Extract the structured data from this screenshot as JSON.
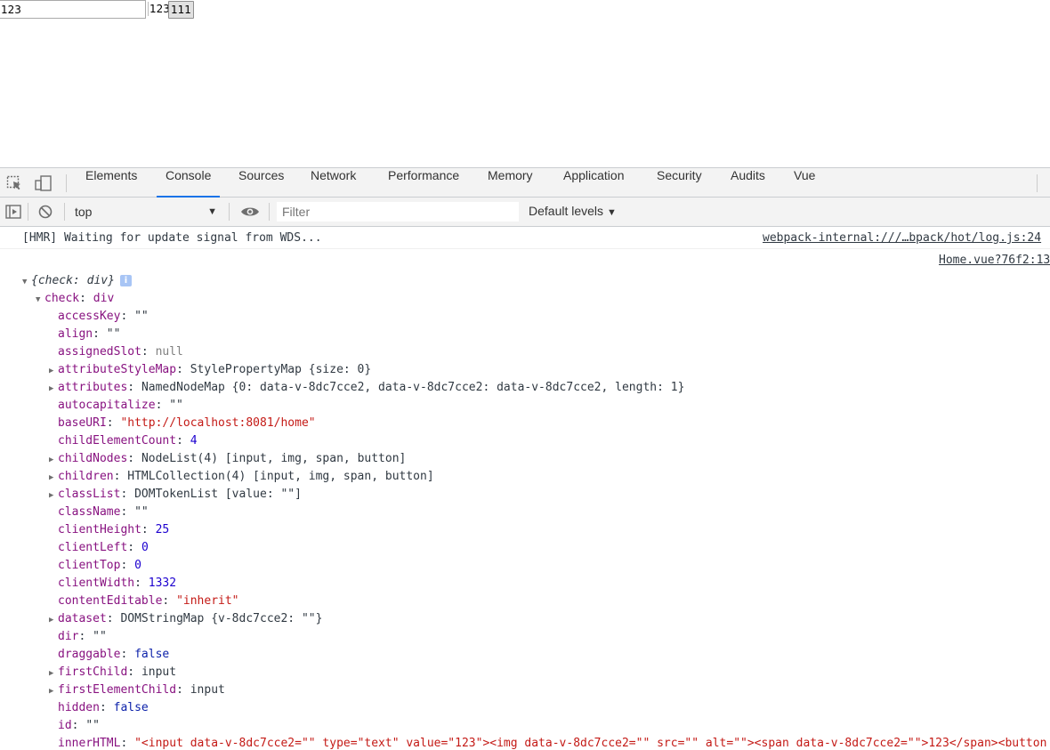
{
  "page": {
    "input_value": "123",
    "span_text": "123",
    "button_label": "111"
  },
  "devtools": {
    "tabs": [
      {
        "label": "Elements"
      },
      {
        "label": "Console"
      },
      {
        "label": "Sources"
      },
      {
        "label": "Network"
      },
      {
        "label": "Performance"
      },
      {
        "label": "Memory"
      },
      {
        "label": "Application"
      },
      {
        "label": "Security"
      },
      {
        "label": "Audits"
      },
      {
        "label": "Vue"
      }
    ],
    "active_tab": "Console",
    "context": "top",
    "filter_placeholder": "Filter",
    "levels_label": "Default levels",
    "accent_color": "#1a73e8"
  },
  "console": {
    "hmr_message": "[HMR] Waiting for update signal from WDS...",
    "hmr_source": "webpack-internal:///…bpack/hot/log.js:24",
    "log_source": "Home.vue?76f2:13",
    "root_label": "{check: div}",
    "check_label": "check",
    "check_value": "div",
    "props": [
      {
        "key": "accessKey",
        "value": "\"\"",
        "type": "plain"
      },
      {
        "key": "align",
        "value": "\"\"",
        "type": "plain"
      },
      {
        "key": "assignedSlot",
        "value": "null",
        "type": "null"
      },
      {
        "key": "attributeStyleMap",
        "value": "StylePropertyMap {size: 0}",
        "type": "obj",
        "expandable": true
      },
      {
        "key": "attributes",
        "value": "NamedNodeMap {0: data-v-8dc7cce2, data-v-8dc7cce2: data-v-8dc7cce2, length: 1}",
        "type": "obj",
        "expandable": true
      },
      {
        "key": "autocapitalize",
        "value": "\"\"",
        "type": "plain"
      },
      {
        "key": "baseURI",
        "value": "\"http://localhost:8081/home\"",
        "type": "str"
      },
      {
        "key": "childElementCount",
        "value": "4",
        "type": "num"
      },
      {
        "key": "childNodes",
        "value": "NodeList(4) [input, img, span, button]",
        "type": "obj",
        "expandable": true
      },
      {
        "key": "children",
        "value": "HTMLCollection(4) [input, img, span, button]",
        "type": "obj",
        "expandable": true
      },
      {
        "key": "classList",
        "value": "DOMTokenList [value: \"\"]",
        "type": "obj",
        "expandable": true
      },
      {
        "key": "className",
        "value": "\"\"",
        "type": "plain"
      },
      {
        "key": "clientHeight",
        "value": "25",
        "type": "num"
      },
      {
        "key": "clientLeft",
        "value": "0",
        "type": "num"
      },
      {
        "key": "clientTop",
        "value": "0",
        "type": "num"
      },
      {
        "key": "clientWidth",
        "value": "1332",
        "type": "num"
      },
      {
        "key": "contentEditable",
        "value": "\"inherit\"",
        "type": "str"
      },
      {
        "key": "dataset",
        "value": "DOMStringMap {v-8dc7cce2: \"\"}",
        "type": "obj",
        "expandable": true
      },
      {
        "key": "dir",
        "value": "\"\"",
        "type": "plain"
      },
      {
        "key": "draggable",
        "value": "false",
        "type": "bool"
      },
      {
        "key": "firstChild",
        "value": "input",
        "type": "obj",
        "expandable": true
      },
      {
        "key": "firstElementChild",
        "value": "input",
        "type": "obj",
        "expandable": true
      },
      {
        "key": "hidden",
        "value": "false",
        "type": "bool"
      },
      {
        "key": "id",
        "value": "\"\"",
        "type": "plain"
      },
      {
        "key": "innerHTML",
        "value": "\"<input data-v-8dc7cce2=\"\" type=\"text\" value=\"123\"><img data-v-8dc7cce2=\"\" src=\"\" alt=\"\"><span data-v-8dc7cce2=\"\">123</span><button",
        "type": "str"
      }
    ]
  }
}
